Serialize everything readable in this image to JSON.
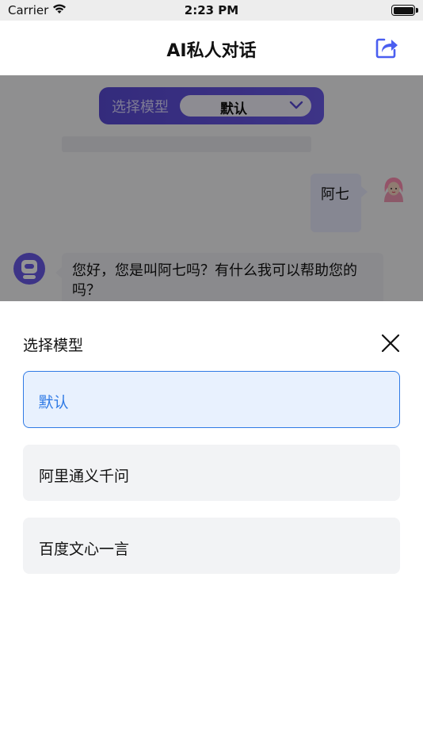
{
  "status_bar": {
    "carrier": "Carrier",
    "time": "2:23 PM"
  },
  "nav": {
    "title": "AI私人对话",
    "share_icon": "share-icon"
  },
  "chat": {
    "model_selector": {
      "label": "选择模型",
      "value": "默认"
    },
    "messages": [
      {
        "role": "user",
        "text": "阿七"
      },
      {
        "role": "bot",
        "text": "您好，您是叫阿七吗？有什么我可以帮助您的吗？"
      }
    ]
  },
  "sheet": {
    "title": "选择模型",
    "options": [
      {
        "label": "默认",
        "selected": true
      },
      {
        "label": "阿里通义千问",
        "selected": false
      },
      {
        "label": "百度文心一言",
        "selected": false
      }
    ]
  },
  "colors": {
    "accent": "#2f7ae5",
    "selector_gradient_start": "#5a4bd6",
    "selector_gradient_end": "#6a5ae8",
    "selected_bg": "#e8f1fe",
    "option_bg": "#f2f3f5"
  }
}
